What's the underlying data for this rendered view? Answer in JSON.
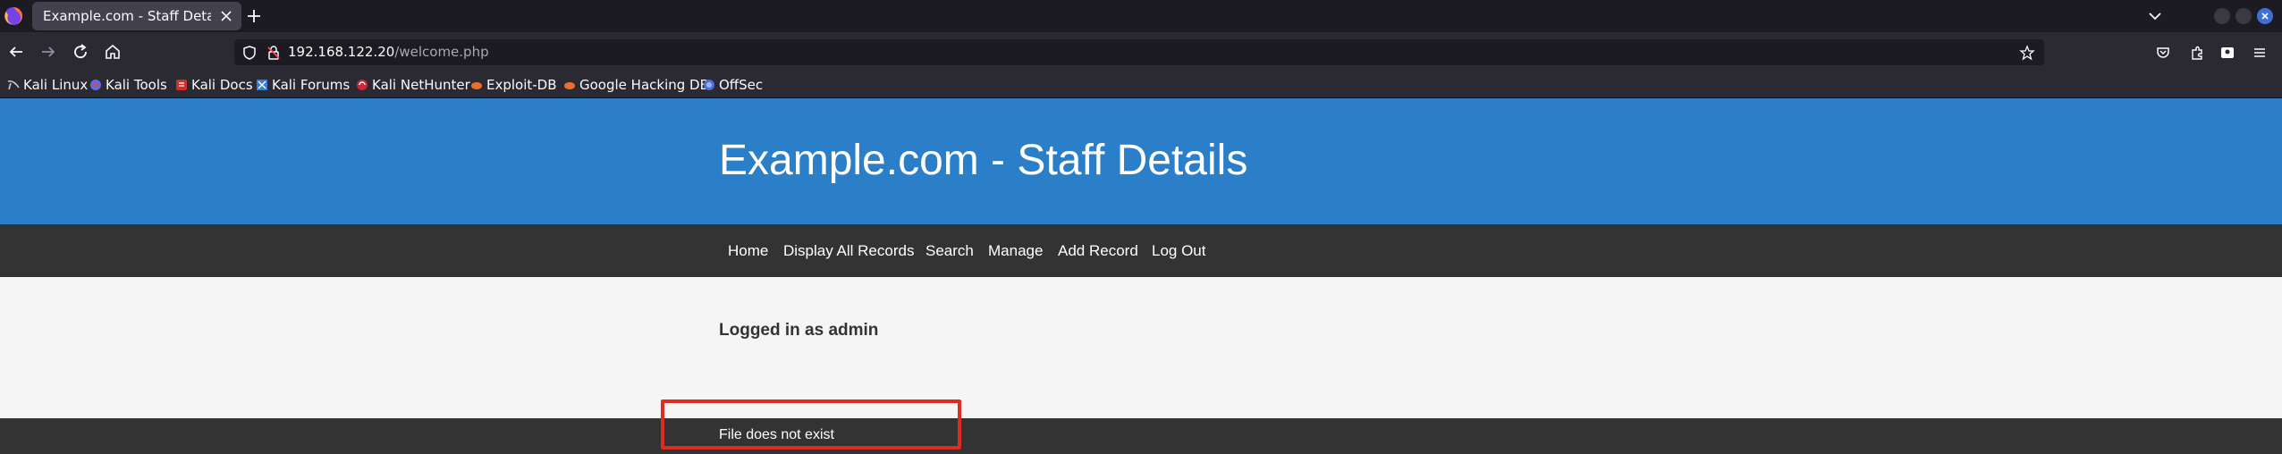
{
  "browser": {
    "tab": {
      "title": "Example.com - Staff Details"
    },
    "url": {
      "host": "192.168.122.20",
      "path": "/welcome.php"
    },
    "icons": [
      "firefox-icon",
      "close-icon",
      "plus-icon",
      "chevron-down-icon",
      "back-icon",
      "forward-icon",
      "reload-icon",
      "home-icon",
      "shield-icon",
      "lock-icon",
      "star-icon",
      "pocket-icon",
      "extensions-icon",
      "account-icon",
      "menu-icon"
    ],
    "bookmarks": [
      {
        "label": "Kali Linux",
        "icon": "kali-dragon-icon"
      },
      {
        "label": "Kali Tools",
        "icon": "kali-tools-icon"
      },
      {
        "label": "Kali Docs",
        "icon": "kali-docs-icon"
      },
      {
        "label": "Kali Forums",
        "icon": "kali-forums-icon"
      },
      {
        "label": "Kali NetHunter",
        "icon": "nethunter-icon"
      },
      {
        "label": "Exploit-DB",
        "icon": "exploit-db-icon"
      },
      {
        "label": "Google Hacking DB",
        "icon": "ghdb-icon"
      },
      {
        "label": "OffSec",
        "icon": "offsec-icon"
      }
    ]
  },
  "page": {
    "title": "Example.com - Staff Details",
    "menu": [
      "Home",
      "Display All Records",
      "Search",
      "Manage",
      "Add Record",
      "Log Out"
    ],
    "logged_in": "Logged in as admin",
    "footer_message": "File does not exist"
  },
  "colors": {
    "header_blue": "#2b7fc8",
    "nav_dark": "#333333",
    "highlight_red": "#e02b20"
  }
}
